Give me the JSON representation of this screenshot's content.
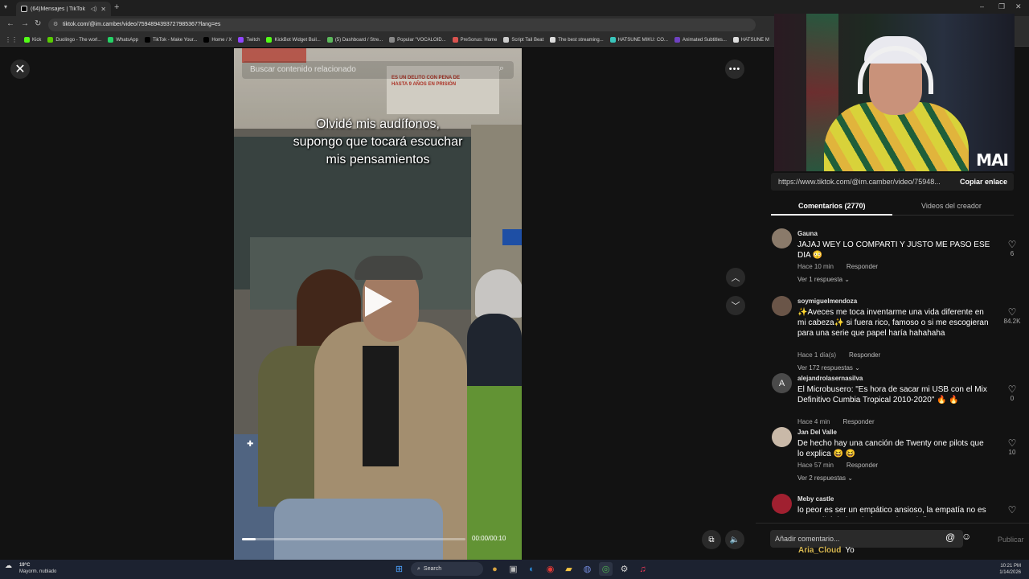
{
  "browser": {
    "tab_title": "(64)Mensajes | TikTok",
    "url": "tiktok.com/@im.camber/video/7594894393727985367?lang=es",
    "bookmarks": [
      {
        "label": "Kick",
        "color": "#53fc18"
      },
      {
        "label": "Duolingo - The worl...",
        "color": "#58cc02"
      },
      {
        "label": "WhatsApp",
        "color": "#25d366"
      },
      {
        "label": "TikTok - Make Your...",
        "color": "#000000"
      },
      {
        "label": "Home / X",
        "color": "#000000"
      },
      {
        "label": "Twitch",
        "color": "#9146ff"
      },
      {
        "label": "KickBot Widget Buil...",
        "color": "#53fc18"
      },
      {
        "label": "(5) Dashboard / Stre...",
        "color": "#5cb85c"
      },
      {
        "label": "Popular \"VOCALOID...",
        "color": "#888888"
      },
      {
        "label": "PreSonus: Home",
        "color": "#d9534f"
      },
      {
        "label": "Script Tail Beat",
        "color": "#cccccc"
      },
      {
        "label": "The best streaming...",
        "color": "#dddddd"
      },
      {
        "label": "HATSUNE MIKU: CO...",
        "color": "#39c5bb"
      },
      {
        "label": "Animated Subtitles...",
        "color": "#6f42c1"
      },
      {
        "label": "HATSUNE M",
        "color": "#dddddd"
      }
    ]
  },
  "video": {
    "search_placeholder": "Buscar contenido relacionado",
    "caption_lines": [
      "Olvidé mis audífonos,",
      "supongo que tocará escuchar",
      "mis pensamientos"
    ],
    "ad_text": "ES UN DELITO CON PENA DE HASTA 9 AÑOS EN PRISIÓN",
    "time": "00:00/00:10",
    "progress": 0.06
  },
  "webcam": {
    "label": "MAI"
  },
  "panel": {
    "link_url": "https://www.tiktok.com/@im.camber/video/75948...",
    "copy_label": "Copiar enlace",
    "tab_comments": "Comentarios (2770)",
    "tab_creator": "Videos del creador",
    "reply_label": "Responder",
    "comments": [
      {
        "user": "Gauna",
        "text": "JAJAJ WEY LO COMPARTI Y JUSTO ME PASO ESE DIA 😳",
        "time": "Hace 10 min",
        "likes": "6",
        "replies": "Ver 1 respuesta",
        "avatar": "#8a7a6a"
      },
      {
        "user": "soymiguelmendoza",
        "text": "✨Aveces me toca inventarme una vida diferente en mi cabeza✨ si fuera rico, famoso o si me escogieran para una serie que papel haría hahahaha",
        "time": "Hace 1 día(s)",
        "likes": "84.2K",
        "replies": "Ver 172 respuestas",
        "avatar": "#6a5548"
      },
      {
        "user": "alejandrolasernasilva",
        "text": "El Microbusero: \"Es hora de sacar mi USB con el Mix Definitivo Cumbia Tropical 2010-2020\" 🔥 🔥",
        "time": "Hace 4 min",
        "likes": "0",
        "replies": "",
        "avatar": "#4a4a4a",
        "initial": "A"
      },
      {
        "user": "Jan Del Valle",
        "text": "De hecho hay una canción de Twenty one pilots que lo explica 😆 😆",
        "time": "Hace 57 min",
        "likes": "10",
        "replies": "Ver 2 respuestas",
        "avatar": "#c9b9a8"
      },
      {
        "user": "Meby castle",
        "text": "lo peor es ser un empático ansioso, la empatía no es una señal de bondad, es más un infierno",
        "time": "",
        "likes": "",
        "replies": "",
        "avatar": "#a02030"
      }
    ],
    "add_comment_placeholder": "Añadir comentario...",
    "post_label": "Publicar",
    "overlay_user": "Aria_Cloud",
    "overlay_msg": "Yo"
  },
  "taskbar": {
    "temp": "19°C",
    "weather": "Mayorm. nublado",
    "search": "Search",
    "time": "10:21 PM",
    "date": "1/14/2026"
  }
}
